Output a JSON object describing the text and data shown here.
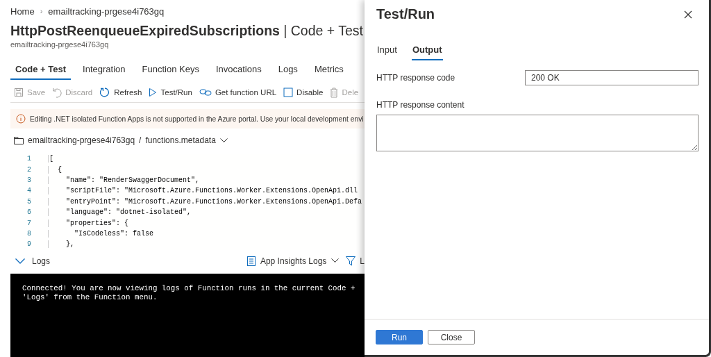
{
  "breadcrumb": [
    "Home",
    "emailtracking-prgese4i763gq"
  ],
  "breadcrumb_separator": "›",
  "title": {
    "name": "HttpPostReenqueueExpiredSubscriptions",
    "separator": "|",
    "section": "Code + Test"
  },
  "subtitle": "emailtracking-prgese4i763gq",
  "tabs": [
    {
      "label": "Code + Test",
      "selected": true
    },
    {
      "label": "Integration",
      "selected": false
    },
    {
      "label": "Function Keys",
      "selected": false
    },
    {
      "label": "Invocations",
      "selected": false
    },
    {
      "label": "Logs",
      "selected": false
    },
    {
      "label": "Metrics",
      "selected": false
    }
  ],
  "toolbar": [
    {
      "kind": "save",
      "label": "Save",
      "disabled": true
    },
    {
      "kind": "discard",
      "label": "Discard",
      "disabled": true
    },
    {
      "kind": "refresh",
      "label": "Refresh",
      "disabled": false
    },
    {
      "kind": "run",
      "label": "Test/Run",
      "disabled": false
    },
    {
      "kind": "url",
      "label": "Get function URL",
      "disabled": false
    },
    {
      "kind": "disable",
      "label": "Disable",
      "disabled": false
    },
    {
      "kind": "delete",
      "label": "Dele",
      "disabled": true
    }
  ],
  "warning": "Editing .NET isolated Function Apps is not supported in the Azure portal. Use your local development envi",
  "file_path": {
    "folder": "emailtracking-prgese4i763gq",
    "separator": "/",
    "file": "functions.metadata"
  },
  "code_lines": [
    {
      "number": "1",
      "text": "["
    },
    {
      "number": "2",
      "text": "  {"
    },
    {
      "number": "3",
      "text": "    \"name\": \"RenderSwaggerDocument\","
    },
    {
      "number": "4",
      "text": "    \"scriptFile\": \"Microsoft.Azure.Functions.Worker.Extensions.OpenApi.dll"
    },
    {
      "number": "5",
      "text": "    \"entryPoint\": \"Microsoft.Azure.Functions.Worker.Extensions.OpenApi.Defa"
    },
    {
      "number": "6",
      "text": "    \"language\": \"dotnet-isolated\","
    },
    {
      "number": "7",
      "text": "    \"properties\": {"
    },
    {
      "number": "8",
      "text": "      \"IsCodeless\": false"
    },
    {
      "number": "9",
      "text": "    },"
    }
  ],
  "logs": {
    "label": "Logs",
    "expanded": true,
    "source": "App Insights Logs",
    "filter": "L",
    "console": [
      "Connected! You are now viewing logs of Function runs in the current Code +",
      "'Logs' from the Function menu."
    ]
  },
  "panel": {
    "title": "Test/Run",
    "tabs": [
      {
        "label": "Input",
        "selected": false
      },
      {
        "label": "Output",
        "selected": true
      }
    ],
    "fields": [
      {
        "kind": "input",
        "label": "HTTP response code",
        "value": "200 OK"
      },
      {
        "kind": "textarea",
        "label": "HTTP response content"
      }
    ],
    "buttons": [
      {
        "label": "Run",
        "primary": true
      },
      {
        "label": "Close",
        "primary": false
      }
    ]
  }
}
